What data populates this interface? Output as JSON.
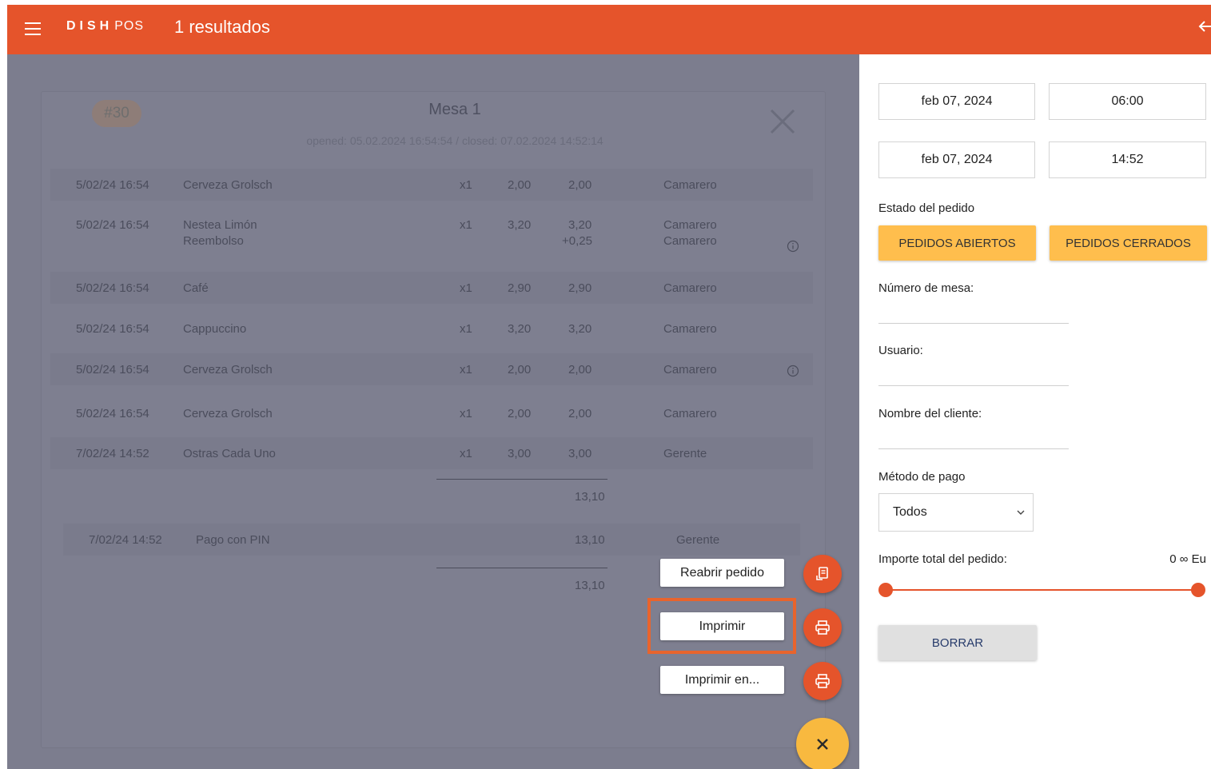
{
  "app": {
    "brand_main": "DISH",
    "brand_suffix": "POS",
    "title": "1 resultados"
  },
  "order": {
    "number": "#30",
    "table": "Mesa 1",
    "times": "opened: 05.02.2024 16:54:54 / closed: 07.02.2024 14:52:14",
    "items": [
      {
        "time": "5/02/24 16:54",
        "name": "Cerveza Grolsch",
        "qty": "x1",
        "price": "2,00",
        "total": "2,00",
        "user": "Camarero"
      },
      {
        "time": "5/02/24 16:54",
        "name": "Nestea Limón",
        "name2": "Reembolso",
        "qty": "x1",
        "price": "3,20",
        "total": "3,20",
        "total2": "+0,25",
        "user": "Camarero",
        "user2": "Camarero"
      },
      {
        "time": "5/02/24 16:54",
        "name": "Café",
        "qty": "x1",
        "price": "2,90",
        "total": "2,90",
        "user": "Camarero"
      },
      {
        "time": "5/02/24 16:54",
        "name": "Cappuccino",
        "qty": "x1",
        "price": "3,20",
        "total": "3,20",
        "user": "Camarero"
      },
      {
        "time": "5/02/24 16:54",
        "name": "Cerveza Grolsch",
        "qty": "x1",
        "price": "2,00",
        "total": "2,00",
        "user": "Camarero"
      },
      {
        "time": "5/02/24 16:54",
        "name": "Cerveza Grolsch",
        "qty": "x1",
        "price": "2,00",
        "total": "2,00",
        "user": "Camarero"
      },
      {
        "time": "7/02/24 14:52",
        "name": "Ostras Cada Uno",
        "qty": "x1",
        "price": "3,00",
        "total": "3,00",
        "user": "Gerente"
      }
    ],
    "subtotal": "13,10",
    "payment": {
      "time": "7/02/24 14:52",
      "method": "Pago con PIN",
      "amount": "13,10",
      "user": "Gerente"
    },
    "total": "13,10"
  },
  "actions": {
    "reopen": "Reabrir pedido",
    "print": "Imprimir",
    "print_in": "Imprimir en..."
  },
  "filters": {
    "date_from": "feb 07, 2024",
    "time_from": "06:00",
    "date_to": "feb 07, 2024",
    "time_to": "14:52",
    "status_label": "Estado del pedido",
    "open_orders": "PEDIDOS ABIERTOS",
    "closed_orders": "PEDIDOS CERRADOS",
    "table_label": "Número de mesa:",
    "user_label": "Usuario:",
    "customer_label": "Nombre del cliente:",
    "payment_label": "Método de pago",
    "payment_value": "Todos",
    "amount_label": "Importe total del pedido:",
    "amount_value": "0 ∞ Eu",
    "clear": "BORRAR"
  },
  "colors": {
    "brand": "#e5542b",
    "accent_yellow": "#ffbe4d",
    "overlay": "#7c7d8e"
  }
}
